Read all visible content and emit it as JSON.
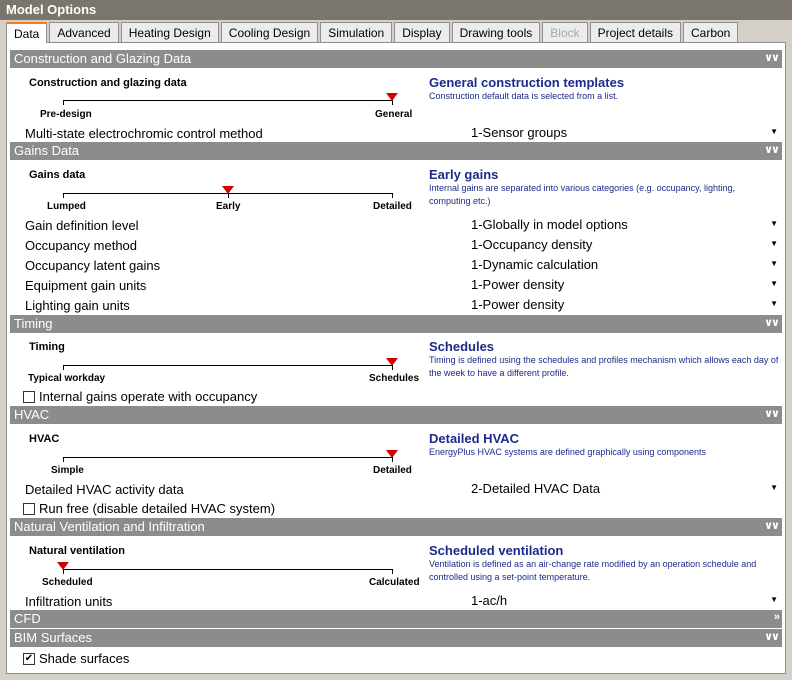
{
  "window": {
    "title": "Model Options"
  },
  "tabs": [
    {
      "label": "Data",
      "active": true,
      "disabled": false
    },
    {
      "label": "Advanced",
      "active": false,
      "disabled": false
    },
    {
      "label": "Heating Design",
      "active": false,
      "disabled": false
    },
    {
      "label": "Cooling Design",
      "active": false,
      "disabled": false
    },
    {
      "label": "Simulation",
      "active": false,
      "disabled": false
    },
    {
      "label": "Display",
      "active": false,
      "disabled": false
    },
    {
      "label": "Drawing tools",
      "active": false,
      "disabled": false
    },
    {
      "label": "Block",
      "active": false,
      "disabled": true
    },
    {
      "label": "Project details",
      "active": false,
      "disabled": false
    },
    {
      "label": "Carbon",
      "active": false,
      "disabled": false
    }
  ],
  "construction": {
    "header": "Construction and Glazing Data",
    "slider_title": "Construction and glazing data",
    "min_label": "Pre-design",
    "max_label": "General",
    "template_title": "General construction templates",
    "template_desc": "Construction default data is selected from a list.",
    "electrochromic_label": "Multi-state electrochromic control method",
    "electrochromic_value": "1-Sensor groups"
  },
  "gains": {
    "header": "Gains Data",
    "slider_title": "Gains data",
    "min_label": "Lumped",
    "mid_label": "Early",
    "max_label": "Detailed",
    "template_title": "Early gains",
    "template_desc": "Internal gains are separated into various categories (e.g. occupancy, lighting, computing etc.)",
    "fields": [
      {
        "label": "Gain definition level",
        "value": "1-Globally in model options"
      },
      {
        "label": "Occupancy method",
        "value": "1-Occupancy density"
      },
      {
        "label": "Occupancy latent gains",
        "value": "1-Dynamic calculation"
      },
      {
        "label": "Equipment gain units",
        "value": "1-Power density"
      },
      {
        "label": "Lighting gain units",
        "value": "1-Power density"
      }
    ]
  },
  "timing": {
    "header": "Timing",
    "slider_title": "Timing",
    "min_label": "Typical workday",
    "max_label": "Schedules",
    "template_title": "Schedules",
    "template_desc": "Timing is defined using the schedules and profiles mechanism which allows each day of the week to have a different profile.",
    "checkbox_label": "Internal gains operate with occupancy",
    "checkbox_checked": false
  },
  "hvac": {
    "header": "HVAC",
    "slider_title": "HVAC",
    "min_label": "Simple",
    "max_label": "Detailed",
    "template_title": "Detailed HVAC",
    "template_desc": "EnergyPlus HVAC systems are defined graphically using components",
    "activity_label": "Detailed HVAC activity data",
    "activity_value": "2-Detailed HVAC Data",
    "checkbox_label": "Run free (disable detailed HVAC system)",
    "checkbox_checked": false
  },
  "ventilation": {
    "header": "Natural Ventilation and Infiltration",
    "slider_title": "Natural ventilation",
    "min_label": "Scheduled",
    "max_label": "Calculated",
    "template_title": "Scheduled ventilation",
    "template_desc": "Ventilation is defined as an air-change rate modified by an operation schedule and controlled using a set-point temperature.",
    "infiltration_label": "Infiltration units",
    "infiltration_value": "1-ac/h"
  },
  "cfd": {
    "header": "CFD"
  },
  "bim": {
    "header": "BIM Surfaces",
    "checkbox_label": "Shade surfaces",
    "checkbox_checked": true
  },
  "icons": {
    "collapse": "double-chevron-down-icon",
    "expand": "double-chevron-right-icon",
    "dropdown": "triangle-down-icon",
    "slider_thumb": "red-triangle-icon"
  },
  "colors": {
    "title_bar": "#7a766e",
    "section_bar": "#8c8c8c",
    "template_text": "#1c2a8a",
    "slider_thumb": "#d40000",
    "active_tab_accent": "#f08020"
  }
}
